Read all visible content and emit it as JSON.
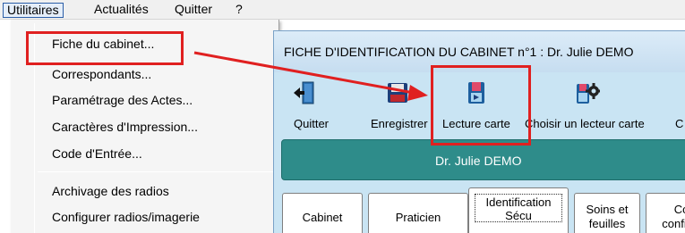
{
  "menubar": {
    "items": [
      "Utilitaires",
      "Actualités",
      "Quitter",
      "?"
    ]
  },
  "dropdown": {
    "items": [
      "Fiche du cabinet...",
      "Correspondants...",
      "Paramétrage des Actes...",
      "Caractères d'Impression...",
      "Code d'Entrée...",
      "Archivage des radios",
      "Configurer radios/imagerie"
    ]
  },
  "window": {
    "title": "FICHE D'IDENTIFICATION DU CABINET n°1 : Dr. Julie DEMO",
    "toolbar": [
      {
        "label": "Quitter",
        "icon": "exit-door-icon"
      },
      {
        "label": "Enregistrer",
        "icon": "save-disk-icon"
      },
      {
        "label": "Lecture carte",
        "icon": "card-reader-icon"
      },
      {
        "label": "Choisir un lecteur carte",
        "icon": "card-reader-settings-icon"
      },
      {
        "label": "C",
        "icon": ""
      }
    ],
    "doctor_name": "Dr. Julie DEMO",
    "tabs": [
      {
        "line1": "Cabinet",
        "line2": ""
      },
      {
        "line1": "Praticien",
        "line2": ""
      },
      {
        "line1": "Identification",
        "line2": "Sécu"
      },
      {
        "line1": "Soins et",
        "line2": "feuilles"
      },
      {
        "line1": "Co",
        "line2": "confi"
      }
    ]
  },
  "colors": {
    "highlight": "#e02020",
    "band": "#2e8c8a",
    "window_bg": "#c9e4f3"
  }
}
